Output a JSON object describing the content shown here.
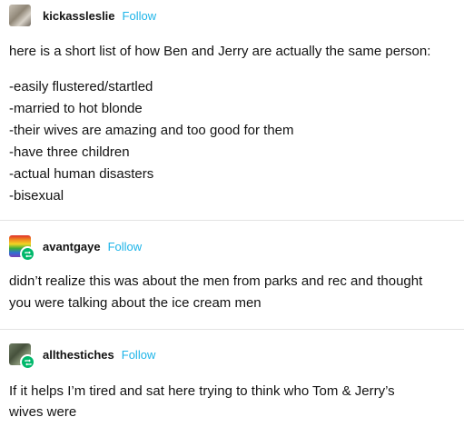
{
  "posts": [
    {
      "username": "kickassleslie",
      "follow_label": "Follow",
      "paragraphs": [
        "here is a short list of how Ben and Jerry are actually the same person:",
        "-easily flustered/startled",
        "-married to hot blonde",
        "-their wives are amazing and too good for them",
        "-have three children",
        "-actual human disasters",
        "-bisexual"
      ]
    },
    {
      "username": "avantgaye",
      "follow_label": "Follow",
      "paragraphs": [
        "didn’t realize this was about the men from parks and rec and thought",
        "you were talking about the ice cream men"
      ]
    },
    {
      "username": "allthestiches",
      "follow_label": "Follow",
      "paragraphs": [
        "If it helps I’m tired and sat here trying to think who Tom & Jerry’s",
        "wives were"
      ]
    }
  ],
  "colors": {
    "follow": "#1db4e8",
    "reblog_badge": "#00b86b",
    "divider": "#e3e3e3"
  }
}
